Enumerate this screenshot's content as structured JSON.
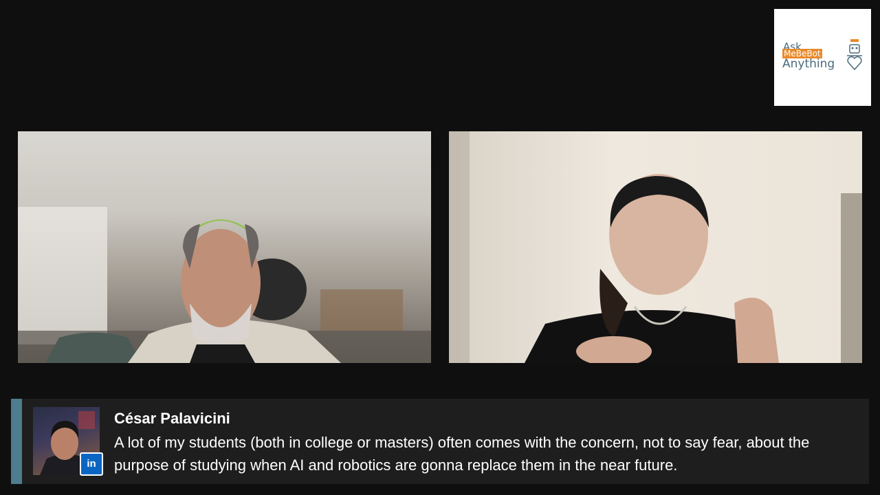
{
  "logo": {
    "line1": "Ask",
    "line2": "MeBeBot",
    "line3": "Anything",
    "brand_colors": {
      "slate": "#4a6b7c",
      "orange": "#e98a2b"
    },
    "icon": "robot-heart-icon"
  },
  "participants": [
    {
      "id": "left",
      "icon": "person-video"
    },
    {
      "id": "right",
      "icon": "person-video"
    }
  ],
  "comment": {
    "author": "César Palavicini",
    "text": "A lot of my students (both in college or masters) often comes with the concern, not to say fear, about the purpose of studying when AI and robotics are gonna replace them in the near future.",
    "platform_badge": "in",
    "platform_icon": "linkedin-icon",
    "accent_color": "#4d7d8f"
  }
}
